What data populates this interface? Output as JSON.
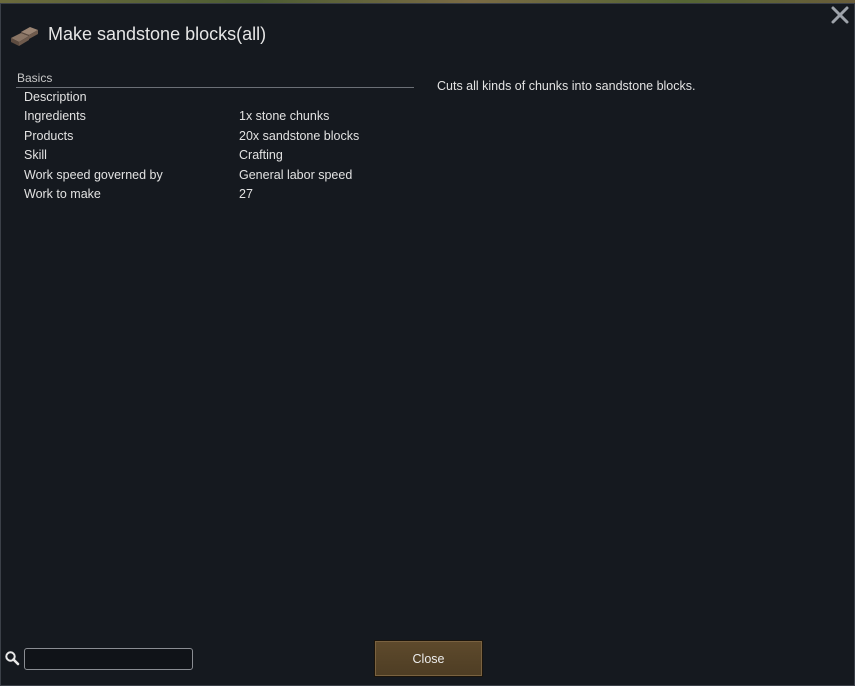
{
  "window": {
    "title": "Make sandstone blocks(all)",
    "icon": "sandstone-blocks-icon",
    "close_icon": "close-icon"
  },
  "stats": {
    "section": "Basics",
    "rows": [
      {
        "label": "Description",
        "value": ""
      },
      {
        "label": "Ingredients",
        "value": "1x stone chunks"
      },
      {
        "label": "Products",
        "value": "20x sandstone blocks"
      },
      {
        "label": "Skill",
        "value": "Crafting"
      },
      {
        "label": "Work speed governed by",
        "value": "General labor speed"
      },
      {
        "label": "Work to make",
        "value": "27"
      }
    ]
  },
  "description": "Cuts all kinds of chunks into sandstone blocks.",
  "footer": {
    "search_icon": "search-icon",
    "search_value": "",
    "close_label": "Close"
  },
  "colors": {
    "background": "#15191f",
    "button": "#5a472a",
    "text": "#e2e2e2"
  }
}
